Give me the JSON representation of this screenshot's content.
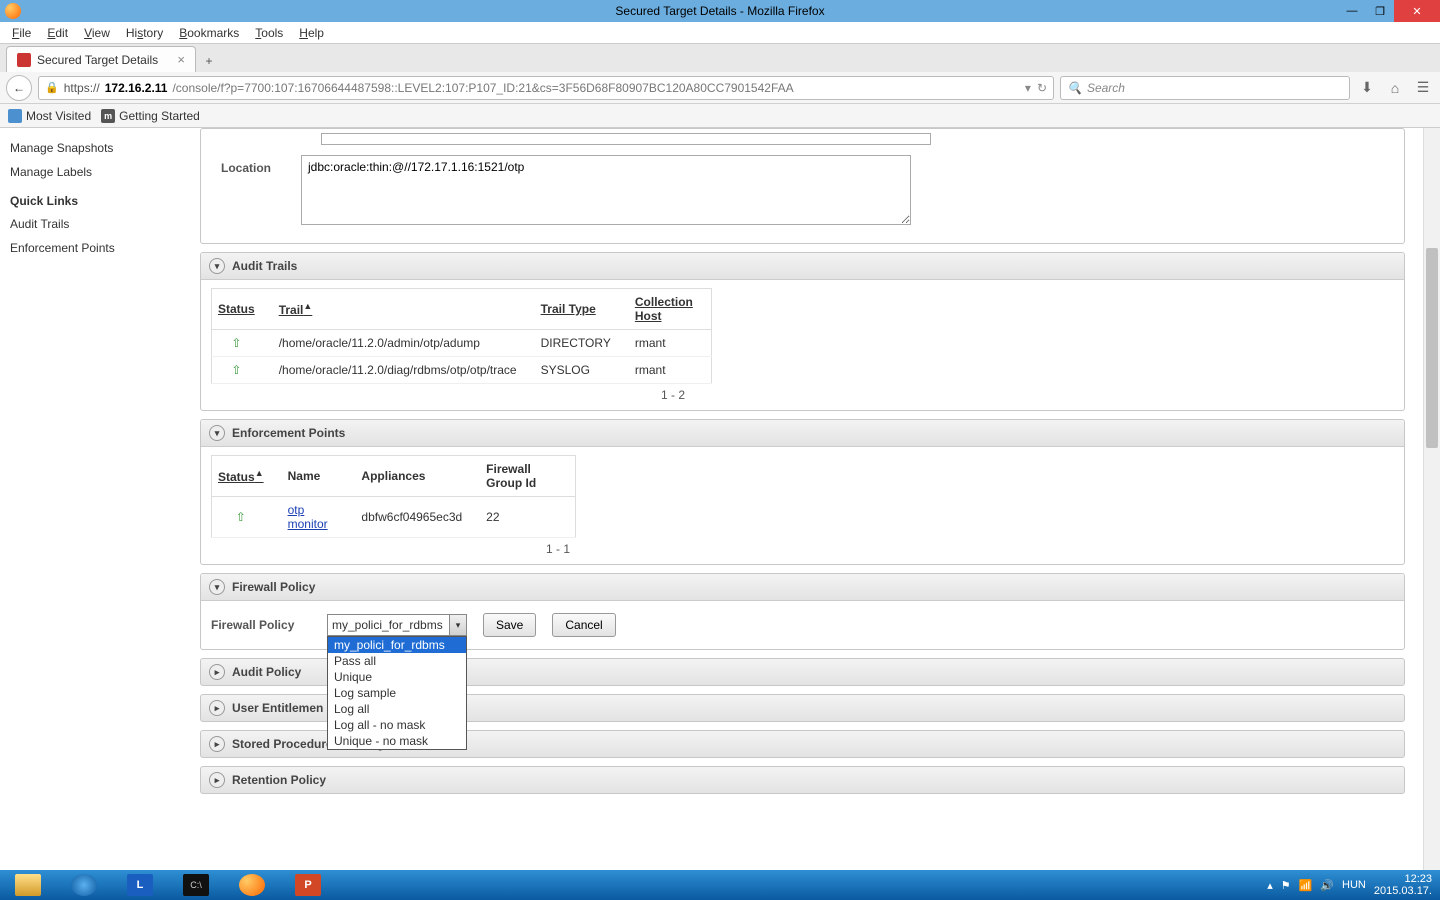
{
  "window": {
    "title": "Secured Target Details - Mozilla Firefox"
  },
  "menubar": {
    "file": "File",
    "edit": "Edit",
    "view": "View",
    "history": "History",
    "bookmarks": "Bookmarks",
    "tools": "Tools",
    "help": "Help"
  },
  "tab": {
    "title": "Secured Target Details"
  },
  "urlbar": {
    "domain": "172.16.2.11",
    "rest": "/console/f?p=7700:107:16706644487598::LEVEL2:107:P107_ID:21&cs=3F56D68F80907BC120A80CC7901542FAA",
    "https_prefix": "https://",
    "search_placeholder": "Search"
  },
  "bookmarks": {
    "most_visited": "Most Visited",
    "getting_started": "Getting Started"
  },
  "sidebar": {
    "manage_snapshots": "Manage Snapshots",
    "manage_labels": "Manage Labels",
    "quick_links": "Quick Links",
    "audit_trails": "Audit Trails",
    "enforcement_points": "Enforcement Points"
  },
  "location": {
    "label": "Location",
    "value": "jdbc:oracle:thin:@//172.17.1.16:1521/otp"
  },
  "audit_trails": {
    "header": "Audit Trails",
    "cols": {
      "status": "Status",
      "trail": "Trail",
      "trail_type": "Trail Type",
      "collection_host": "Collection Host"
    },
    "sort_indicator": "▲",
    "rows": [
      {
        "status": "⇧",
        "trail": "/home/oracle/11.2.0/admin/otp/adump",
        "type": "DIRECTORY",
        "host": "rmant"
      },
      {
        "status": "⇧",
        "trail": "/home/oracle/11.2.0/diag/rdbms/otp/otp/trace",
        "type": "SYSLOG",
        "host": "rmant"
      }
    ],
    "pager": "1 - 2"
  },
  "enforcement": {
    "header": "Enforcement Points",
    "cols": {
      "status": "Status",
      "name": "Name",
      "appliances": "Appliances",
      "fgid": "Firewall Group Id"
    },
    "sort_indicator": "▲",
    "row": {
      "status": "⇧",
      "name": "otp monitor",
      "appliance": "dbfw6cf04965ec3d",
      "fgid": "22"
    },
    "pager": "1 - 1"
  },
  "firewall_policy": {
    "header": "Firewall Policy",
    "label": "Firewall Policy",
    "selected": "my_polici_for_rdbms",
    "options": [
      "my_polici_for_rdbms",
      "Pass all",
      "Unique",
      "Log sample",
      "Log all",
      "Log all - no mask",
      "Unique - no mask"
    ],
    "save": "Save",
    "cancel": "Cancel"
  },
  "collapsed_sections": {
    "audit_policy": "Audit Policy",
    "user_entitlement": "User Entitlemen",
    "stored_procedure": "Stored Procedure Auditing",
    "retention": "Retention Policy"
  },
  "tray": {
    "lang": "HUN",
    "time": "12:23",
    "date": "2015.03.17."
  }
}
